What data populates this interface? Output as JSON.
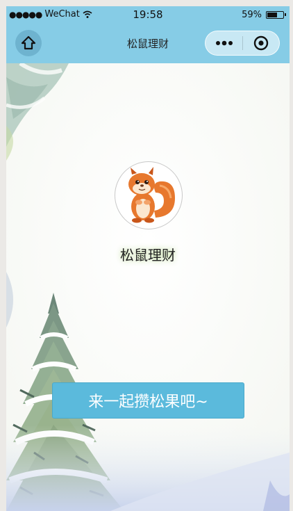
{
  "status_bar": {
    "signal": "●●●●●",
    "carrier": "WeChat",
    "time": "19:58",
    "battery_text": "59%",
    "battery_level": 0.59
  },
  "nav": {
    "title": "松鼠理财",
    "home_icon": "home-icon",
    "more_icon": "more-dots-icon",
    "close_icon": "target-close-icon",
    "background_color": "#86cce6"
  },
  "main": {
    "app_name": "松鼠理财",
    "avatar_icon": "squirrel-avatar",
    "button_label": "来一起攒松果吧~",
    "button_color": "#5bbadc"
  }
}
